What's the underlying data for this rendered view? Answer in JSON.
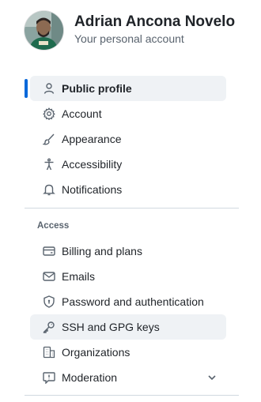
{
  "profile": {
    "name": "Adrian Ancona Novelo",
    "subtitle": "Your personal account"
  },
  "nav_top": [
    {
      "label": "Public profile",
      "icon": "person-icon",
      "active": true
    },
    {
      "label": "Account",
      "icon": "gear-icon"
    },
    {
      "label": "Appearance",
      "icon": "paintbrush-icon"
    },
    {
      "label": "Accessibility",
      "icon": "accessibility-icon"
    },
    {
      "label": "Notifications",
      "icon": "bell-icon"
    }
  ],
  "access_section": {
    "title": "Access",
    "items": [
      {
        "label": "Billing and plans",
        "icon": "credit-card-icon"
      },
      {
        "label": "Emails",
        "icon": "mail-icon"
      },
      {
        "label": "Password and authentication",
        "icon": "shield-lock-icon"
      },
      {
        "label": "SSH and GPG keys",
        "icon": "key-icon",
        "hovered": true
      },
      {
        "label": "Organizations",
        "icon": "organization-icon"
      },
      {
        "label": "Moderation",
        "icon": "report-icon",
        "expandable": true
      }
    ]
  },
  "colors": {
    "accent": "#0969da",
    "active_bg": "#eff2f5",
    "text": "#1f2328",
    "muted": "#59636e",
    "divider": "#d1d9e0"
  }
}
